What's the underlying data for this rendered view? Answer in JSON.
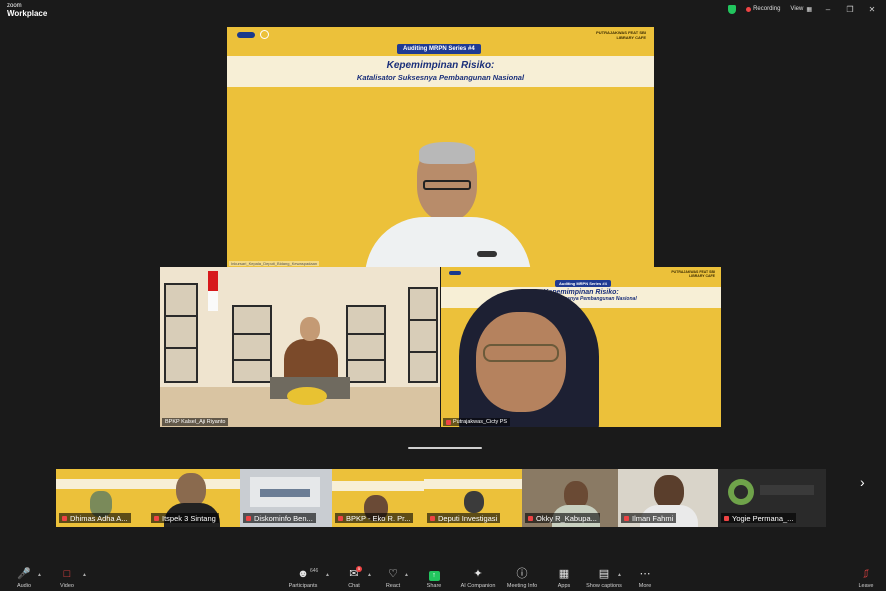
{
  "app": {
    "brand_small": "zoom",
    "brand_large": "Workplace",
    "recording_label": "Recording",
    "view_label": "View"
  },
  "main_slide": {
    "series": "Auditing MRPN Series #4",
    "title": "Kepemimpinan Risiko:",
    "subtitle": "Katalisator Suksesnya Pembangunan Nasional",
    "org_line1": "PUTRAJAKWAS FEAT SBI",
    "org_line2": "LIBRARY CAFE",
    "speaker_label": "Inkursari_Kepala_Deputi_Bidang_Kewaspadaan"
  },
  "gallery": [
    {
      "name": "BPKP Kalsel_Aji Riyanto"
    },
    {
      "name": "Putrajakwas_Cicty PS"
    }
  ],
  "woman_slide": {
    "series": "Auditing MRPN Series #4",
    "title": "Kepemimpinan Risiko:",
    "subtitle": "Katalisator Suksesnya Pembangunan Nasional",
    "org_line1": "PUTRAJAKWAS FEAT SBI",
    "org_line2": "LIBRARY CAFE"
  },
  "filmstrip": [
    {
      "name": "Dhimas Adha A..."
    },
    {
      "name": "Itspek 3 Sintang"
    },
    {
      "name": "Diskominfo Ben..."
    },
    {
      "name": "BPKP - Eko R. Pr..."
    },
    {
      "name": "Deputi Investigasi"
    },
    {
      "name": "Okky R_Kabupa..."
    },
    {
      "name": "Ilman Fahmi"
    },
    {
      "name": "Yogie Permana_..."
    }
  ],
  "toolbar": {
    "audio": "Audio",
    "video": "Video",
    "participants": "Participants",
    "participants_count": "646",
    "chat": "Chat",
    "chat_badge": "5",
    "react": "React",
    "share": "Share",
    "ai_companion": "AI Companion",
    "meeting_info": "Meeting Info",
    "apps": "Apps",
    "show_captions": "Show captions",
    "more": "More",
    "leave": "Leave"
  },
  "colors": {
    "slide_yellow": "#ecc13a",
    "slide_navy": "#1a2f7a",
    "record_red": "#ef4444",
    "secure_green": "#22c55e"
  }
}
